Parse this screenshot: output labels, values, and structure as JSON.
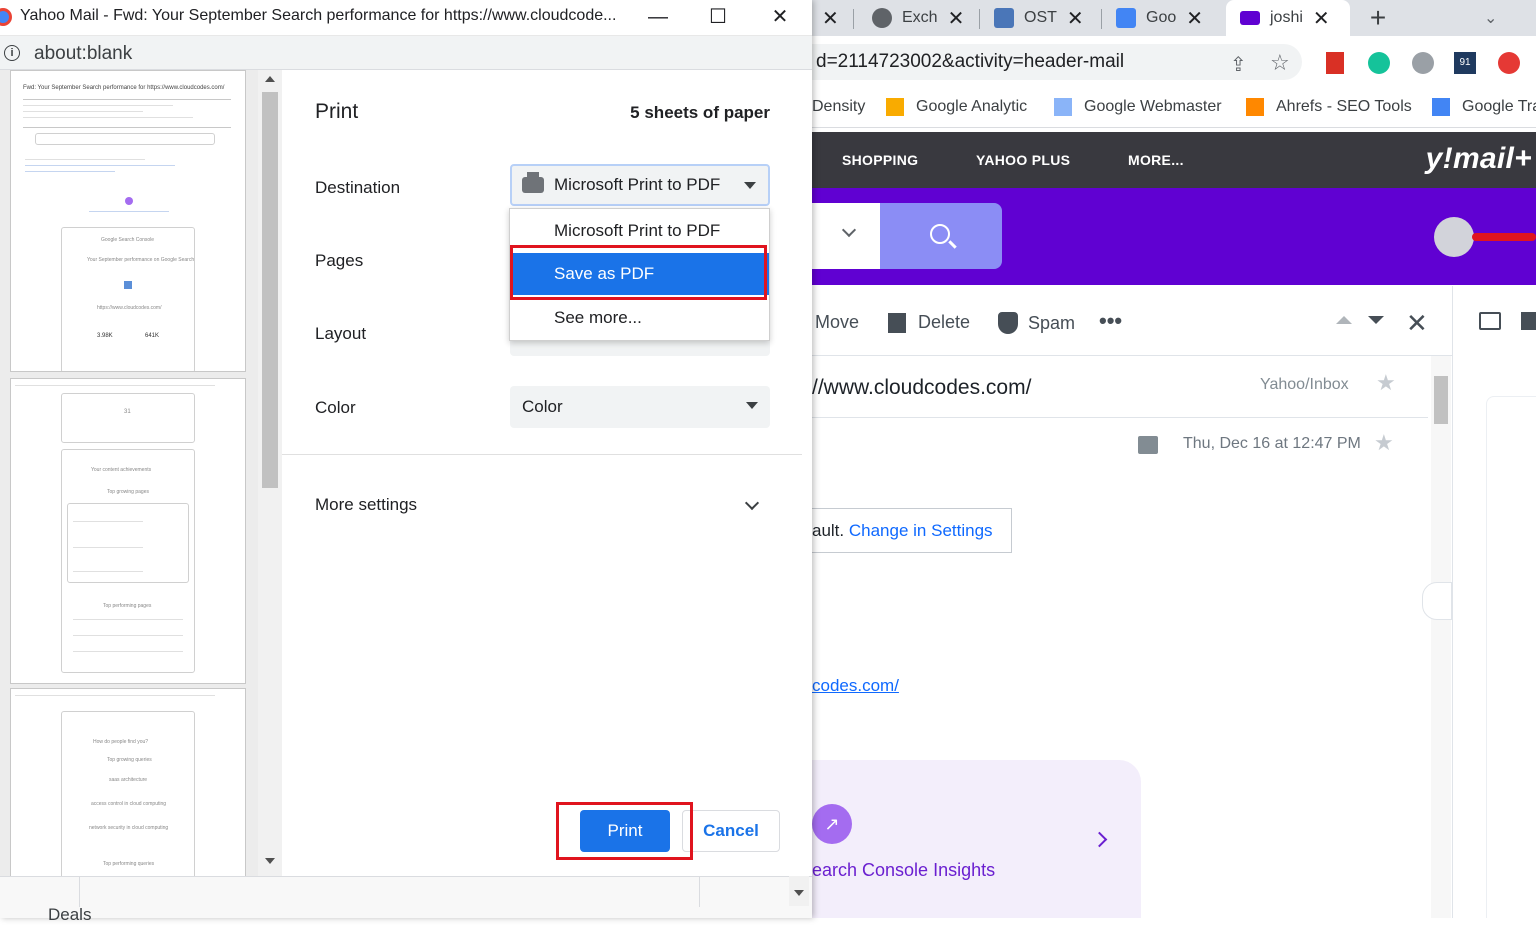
{
  "window": {
    "title": "Yahoo Mail - Fwd: Your September Search performance for https://www.cloudcode...",
    "url": "about:blank"
  },
  "print": {
    "title": "Print",
    "sheets": "5 sheets of paper",
    "destination_label": "Destination",
    "destination_value": "Microsoft Print to PDF",
    "pages_label": "Pages",
    "layout_label": "Layout",
    "color_label": "Color",
    "color_value": "Color",
    "more_settings": "More settings",
    "print_button": "Print",
    "cancel_button": "Cancel"
  },
  "dropdown": {
    "options": [
      "Microsoft Print to PDF",
      "Save as PDF",
      "See more..."
    ],
    "selected": "Save as PDF"
  },
  "preview": {
    "page1_heading": "Fwd: Your September Search performance for https://www.cloudcodes.com/",
    "page1_card_brand": "Google Search Console",
    "page1_card_title": "Your September performance on Google Search",
    "page1_site": "https://www.cloudcodes.com/",
    "page1_stat1": "3.98K",
    "page1_stat2": "641K",
    "page2_count": "31",
    "page2_heading": "Your content achievements",
    "page2_sub": "Top growing pages",
    "page2_sub2": "Top performing pages",
    "page3_heading": "How do people find you?",
    "page3_sub": "Top growing queries",
    "page3_q1": "saas architecture",
    "page3_q2": "access control in cloud computing",
    "page3_q3": "network security in cloud computing",
    "page3_sub2": "Top performing queries"
  },
  "background": {
    "tabs": [
      {
        "label": "Exch",
        "icon": "globe-icon"
      },
      {
        "label": "OST",
        "icon": "shield-icon"
      },
      {
        "label": "Goo",
        "icon": "google-translate-icon"
      },
      {
        "label": "joshi",
        "icon": "mail-icon"
      }
    ],
    "address_text": "d=2114723002&activity=header-mail",
    "bookmarks": [
      "Density",
      "Google Analytic",
      "Google Webmaster",
      "Ahrefs - SEO Tools",
      "Google Tra"
    ],
    "nav": [
      "SHOPPING",
      "YAHOO PLUS",
      "MORE..."
    ],
    "logo": "y!mail+",
    "toolbar": [
      "Move",
      "Delete",
      "Spam"
    ],
    "subject": "//www.cloudcodes.com/",
    "folder": "Yahoo/Inbox",
    "date": "Thu, Dec 16 at 12:47 PM",
    "settings_prefix": "ault.",
    "settings_link": "Change in Settings",
    "body_link": "codes.com/",
    "insight_text": "earch Console Insights",
    "footer_text": "Deals"
  },
  "colors": {
    "accent": "#1a73e8",
    "highlight": "#e0141e",
    "yahoo_purple": "#6001d2"
  }
}
